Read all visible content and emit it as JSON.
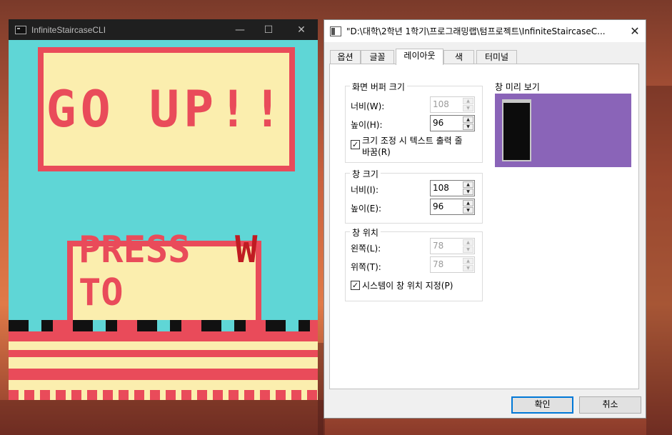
{
  "game_window": {
    "title": "InfiniteStaircaseCLI",
    "sign_top": "GO UP!!",
    "sign_bottom_line1": "PRESS",
    "sign_bottom_key": "W",
    "sign_bottom_line2": "TO START"
  },
  "dialog": {
    "title": "\"D:\\대학\\2학년 1학기\\프로그래밍랩\\텀프로젝트\\InfiniteStaircaseC...",
    "tabs": [
      {
        "label": "옵션",
        "active": false
      },
      {
        "label": "글꼴",
        "active": false
      },
      {
        "label": "레이아웃",
        "active": true
      },
      {
        "label": "색",
        "active": false
      },
      {
        "label": "터미널",
        "active": false
      }
    ],
    "buffer": {
      "title": "화면 버퍼 크기",
      "width_label": "너비(W):",
      "width_value": "108",
      "height_label": "높이(H):",
      "height_value": "96",
      "wrap_label_line1": "크기 조정 시 텍스트 출력 줄",
      "wrap_label_line2": "바꿈(R)",
      "wrap_checked": true
    },
    "window_size": {
      "title": "창 크기",
      "width_label": "너비(I):",
      "width_value": "108",
      "height_label": "높이(E):",
      "height_value": "96"
    },
    "window_position": {
      "title": "창 위치",
      "left_label": "왼쪽(L):",
      "left_value": "78",
      "top_label": "위쪽(T):",
      "top_value": "78",
      "system_label": "시스템이 창 위치 지정(P)",
      "system_checked": true
    },
    "preview_title": "창 미리 보기",
    "ok_label": "확인",
    "cancel_label": "취소",
    "colors": {
      "preview_bg": "#8a64b8",
      "accent": "#0078d7"
    }
  }
}
